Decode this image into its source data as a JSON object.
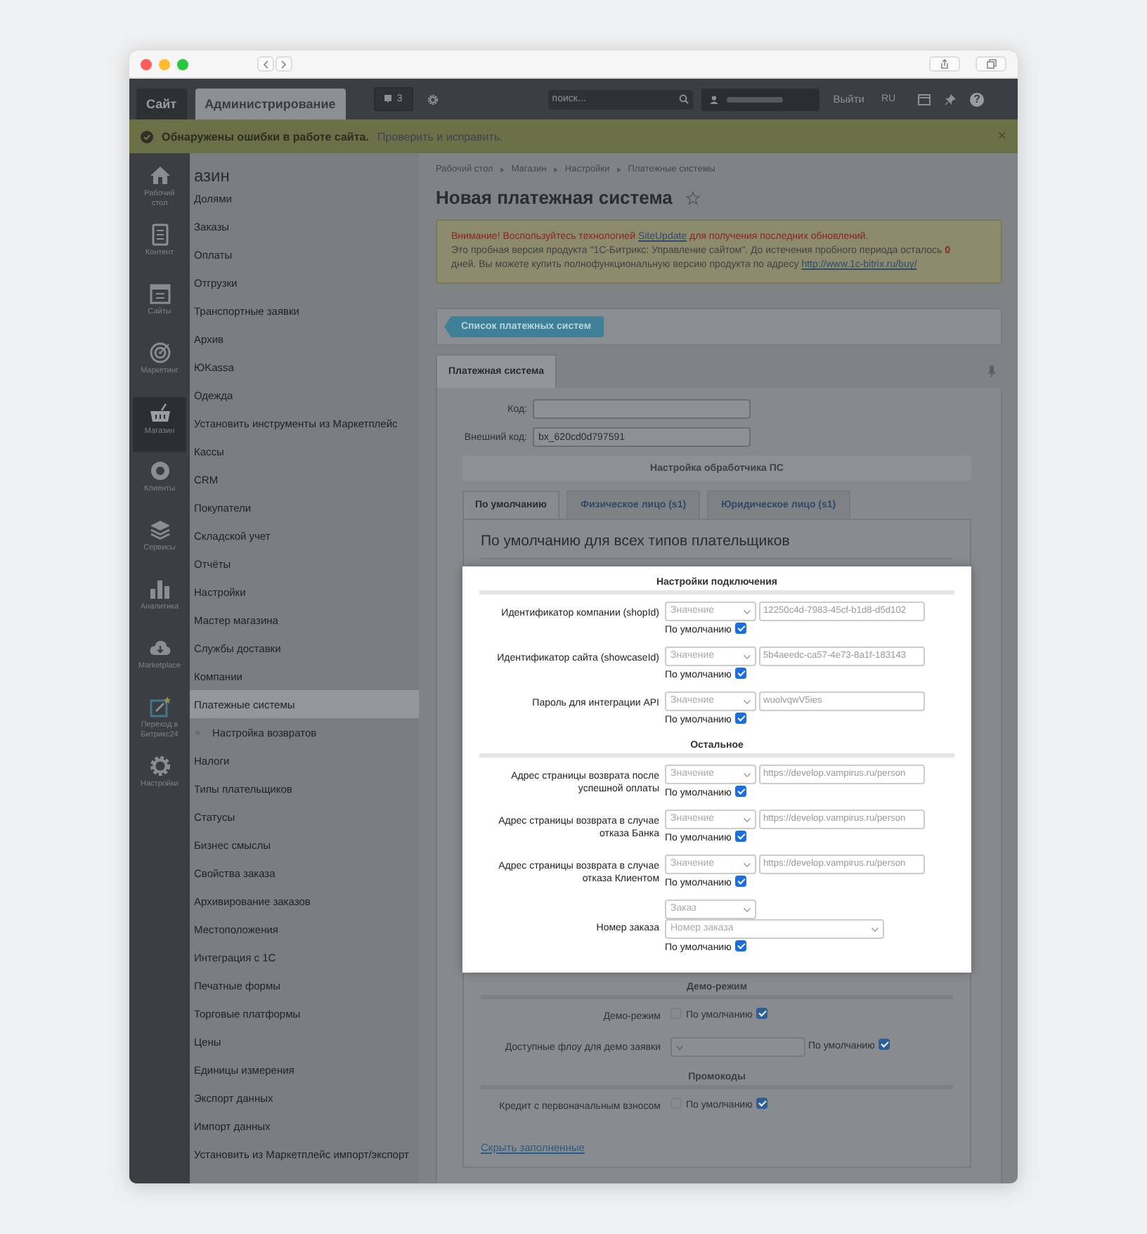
{
  "admin_bar": {
    "tabs": [
      {
        "label": "Сайт",
        "selected": false
      },
      {
        "label": "Администрирование",
        "selected": true
      }
    ],
    "notifications_count": "3",
    "search": {
      "placeholder": "поиск..."
    },
    "logout": "Выйти",
    "language": "RU",
    "help": "?"
  },
  "alert_bar": {
    "message": "Обнаружены ошибки в работе сайта.",
    "link": "Проверить и исправить.",
    "close": "×"
  },
  "sidebar": {
    "items": [
      {
        "label": "Рабочий стол",
        "selected": false
      },
      {
        "label": "Контент",
        "selected": false
      },
      {
        "label": "Сайты",
        "selected": false
      },
      {
        "label": "Маркетинг",
        "selected": false
      },
      {
        "label": "Магазин",
        "selected": true
      },
      {
        "label": "Клиенты",
        "selected": false
      },
      {
        "label": "Сервисы",
        "selected": false
      },
      {
        "label": "Аналитика",
        "selected": false
      },
      {
        "label": "Marketplace",
        "selected": false
      },
      {
        "label": "Переход в Битрикс24",
        "selected": false
      },
      {
        "label": "Настройки",
        "selected": false
      }
    ]
  },
  "menu": {
    "title": "азин",
    "items": [
      {
        "label": "Долями",
        "selected": false
      },
      {
        "label": "Заказы",
        "selected": false
      },
      {
        "label": "Оплаты",
        "selected": false
      },
      {
        "label": "Отгрузки",
        "selected": false
      },
      {
        "label": "Транспортные заявки",
        "selected": false
      },
      {
        "label": "Архив",
        "selected": false
      },
      {
        "label": "ЮKassa",
        "selected": false
      },
      {
        "label": "Одежда",
        "selected": false
      },
      {
        "label": "Установить инструменты из Маркетплейс",
        "selected": false
      },
      {
        "label": "Кассы",
        "selected": false
      },
      {
        "label": "CRM",
        "selected": false
      },
      {
        "label": "Покупатели",
        "selected": false
      },
      {
        "label": "Складской учет",
        "selected": false
      },
      {
        "label": "Отчёты",
        "selected": false
      },
      {
        "label": "Настройки",
        "selected": false
      },
      {
        "label": "Мастер магазина",
        "selected": false
      },
      {
        "label": "Службы доставки",
        "selected": false
      },
      {
        "label": "Компании",
        "selected": false
      },
      {
        "label": "Платежные системы",
        "selected": true,
        "children": [
          {
            "label": "Настройка возвратов",
            "selected": false
          }
        ]
      },
      {
        "label": "Налоги",
        "selected": false
      },
      {
        "label": "Типы плательщиков",
        "selected": false
      },
      {
        "label": "Статусы",
        "selected": false
      },
      {
        "label": "Бизнес смыслы",
        "selected": false
      },
      {
        "label": "Свойства заказа",
        "selected": false
      },
      {
        "label": "Архивирование заказов",
        "selected": false
      },
      {
        "label": "Местоположения",
        "selected": false
      },
      {
        "label": "Интеграция с 1С",
        "selected": false
      },
      {
        "label": "Печатные формы",
        "selected": false
      },
      {
        "label": "Торговые платформы",
        "selected": false
      },
      {
        "label": "Цены",
        "selected": false
      },
      {
        "label": "Единицы измерения",
        "selected": false
      },
      {
        "label": "Экспорт данных",
        "selected": false
      },
      {
        "label": "Импорт данных",
        "selected": false
      },
      {
        "label": "Установить из Маркетплейс импорт/экспорт",
        "selected": false
      }
    ]
  },
  "breadcrumbs": [
    "Рабочий стол",
    "Магазин",
    "Настройки",
    "Платежные системы"
  ],
  "page_title": "Новая платежная система",
  "notice": {
    "warning_before": "Внимание! Воспользуйтесь технологией ",
    "warning_link": "SiteUpdate",
    "warning_after": " для получения последних обновлений.",
    "info": "Это пробная версия продукта \"1С-Битрикс: Управление сайтом\". До истечения пробного периода осталось **0** дней. Вы можете купить полнофункциональную версию продукта по адресу ",
    "info_link": "http://www.1c-bitrix.ru/buy/"
  },
  "toolbar": {
    "back_button": "Список платежных систем"
  },
  "form_tabs": [
    {
      "label": "Платежная система",
      "selected": true
    }
  ],
  "fields": [
    {
      "label": "Код:"
    },
    {
      "label": "Внешний код:",
      "value": "bx_620cd0d797591"
    }
  ],
  "handler_section": "Настройка обработчика ПС",
  "payer_tabs": [
    {
      "label": "По умолчанию",
      "selected": true
    },
    {
      "label": "Физическое лицо (s1)",
      "selected": false
    },
    {
      "label": "Юридическое лицо (s1)",
      "selected": false
    }
  ],
  "payer_heading": "По умолчанию для всех типов плательщиков",
  "highlighted_groups": [
    {
      "title": "Настройки подключения",
      "rows": [
        {
          "kind": "text",
          "label": "Идентификатор компании (shopId)",
          "source": "Значение",
          "value": "12250c4d-7983-45cf-b1d8-d5d102",
          "default_label": "По умолчанию",
          "default_checked": true
        },
        {
          "kind": "text",
          "label": "Идентификатор сайта (showcaseId)",
          "source": "Значение",
          "value": "5b4aeedc-ca57-4e73-8a1f-183143",
          "default_label": "По умолчанию",
          "default_checked": true
        },
        {
          "kind": "text",
          "label": "Пароль для интеграции API",
          "source": "Значение",
          "value": "wuolvqwV5ies",
          "default_label": "По умолчанию",
          "default_checked": true
        }
      ]
    },
    {
      "title": "Остальное",
      "rows": [
        {
          "kind": "text",
          "label": "Адрес страницы возврата после успешной оплаты",
          "source": "Значение",
          "value": "https://develop.vampirus.ru/person",
          "default_label": "По умолчанию",
          "default_checked": true
        },
        {
          "kind": "text",
          "label": "Адрес страницы возврата в случае отказа Банка",
          "source": "Значение",
          "value": "https://develop.vampirus.ru/person",
          "default_label": "По умолчанию",
          "default_checked": true
        },
        {
          "kind": "text",
          "label": "Адрес страницы возврата в случае отказа Клиентом",
          "source": "Значение",
          "value": "https://develop.vampirus.ru/person",
          "default_label": "По умолчанию",
          "default_checked": true
        },
        {
          "kind": "order",
          "label": "Номер заказа",
          "source": "Заказ",
          "select_placeholder": "Номер заказа",
          "default_label": "По умолчанию",
          "default_checked": true
        }
      ]
    }
  ],
  "groups": [
    {
      "title": "Демо-режим",
      "rows": [
        {
          "kind": "checkbox",
          "label": "Демо-режим",
          "checked": false,
          "disabled": true,
          "default_label": "По умолчанию",
          "default_checked": true
        },
        {
          "kind": "select",
          "label": "Доступные флоу для демо заявки",
          "default_label": "По умолчанию",
          "default_checked": true
        }
      ]
    },
    {
      "title": "Промокоды",
      "rows": [
        {
          "kind": "checkbox",
          "label": "Кредит с первоначальным взносом",
          "checked": false,
          "disabled": true,
          "default_label": "По умолчанию",
          "default_checked": true
        }
      ]
    }
  ],
  "hide_link": "Скрыть заполненные"
}
